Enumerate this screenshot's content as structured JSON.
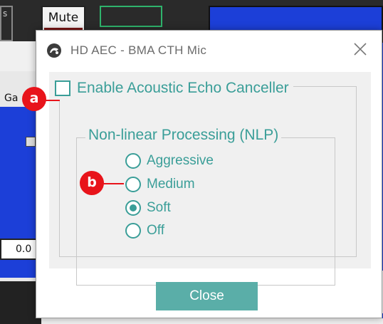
{
  "background": {
    "left_tab_text": "s",
    "mute_label": "Mute",
    "gain_label_partial": "Ga",
    "value_partial": "0.0"
  },
  "dialog": {
    "title": "HD AEC - BMA CTH Mic",
    "aec_checkbox_label": "Enable Acoustic Echo Canceller",
    "aec_checked": false,
    "nlp_group_title": "Non-linear Processing (NLP)",
    "nlp_options": [
      {
        "label": "Aggressive",
        "selected": false
      },
      {
        "label": "Medium",
        "selected": false
      },
      {
        "label": "Soft",
        "selected": true
      },
      {
        "label": "Off",
        "selected": false
      }
    ],
    "close_button_label": "Close"
  },
  "annotations": {
    "a": "a",
    "b": "b"
  },
  "colors": {
    "accent_teal": "#3a9e98",
    "button_teal": "#5aaea8",
    "badge_red": "#e8141b",
    "background_blue": "#1c3fd8"
  },
  "icons": {
    "app": "app-logo-icon",
    "close": "close-icon"
  }
}
